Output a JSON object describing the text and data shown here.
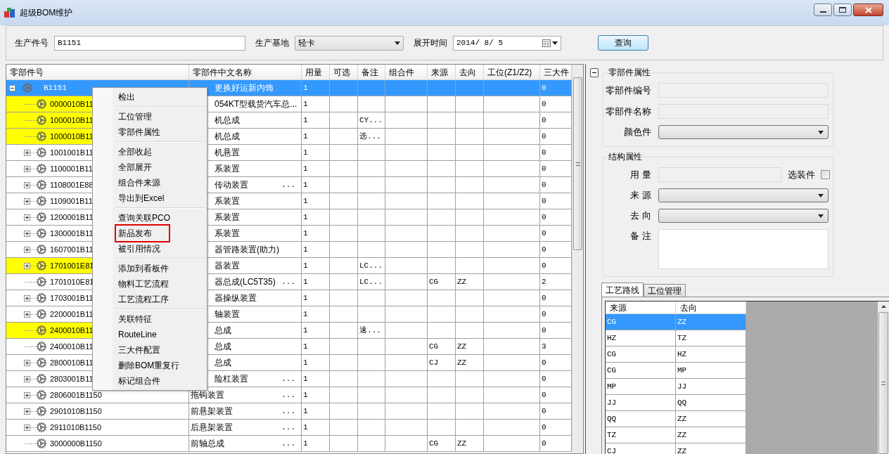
{
  "window": {
    "title": "超级BOM维护"
  },
  "query": {
    "fields": [
      {
        "kind": "text",
        "label": "生产件号",
        "value": "B1151"
      },
      {
        "kind": "select",
        "label": "生产基地",
        "value": "轻卡"
      },
      {
        "kind": "date",
        "label": "展开时间",
        "value": "2014/ 8/ 5"
      }
    ],
    "button": "查询"
  },
  "bom_grid": {
    "columns": [
      "零部件号",
      "零部件中文名称",
      "用量",
      "可选",
      "备注",
      "组合件",
      "来源",
      "去向",
      "工位(Z1/Z2)",
      "三大件"
    ],
    "tree": {
      "part": "B1151",
      "name": "更换好运新内饰",
      "qty": "1",
      "three": "0",
      "selected": true,
      "expanded": true,
      "children": [
        {
          "part": "0000010B11",
          "name": "054KT型载货汽车总...",
          "qty": "1",
          "three": "0",
          "highlight": true,
          "expandable": false
        },
        {
          "part": "1000010B11",
          "name": "机总成",
          "qty": "1",
          "remark": "CY...",
          "three": "0",
          "highlight": true,
          "expandable": false
        },
        {
          "part": "1000010B11",
          "name": "机总成",
          "qty": "1",
          "remark": "选...",
          "three": "0",
          "highlight": true,
          "expandable": false
        },
        {
          "part": "1001001B11",
          "name": "机悬置",
          "qty": "1",
          "three": "0",
          "highlight": false,
          "expandable": true
        },
        {
          "part": "1100001B11",
          "name": "系装置",
          "qty": "1",
          "three": "0",
          "highlight": false,
          "expandable": true
        },
        {
          "part": "1108001E88",
          "name": "传动装置",
          "ellipsis": "...",
          "qty": "1",
          "three": "0",
          "highlight": false,
          "expandable": true
        },
        {
          "part": "1109001B11",
          "name": "系装置",
          "qty": "1",
          "three": "0",
          "highlight": false,
          "expandable": true
        },
        {
          "part": "1200001B11",
          "name": "系装置",
          "qty": "1",
          "three": "0",
          "highlight": false,
          "expandable": true
        },
        {
          "part": "1300001B11",
          "name": "系装置",
          "qty": "1",
          "three": "0",
          "highlight": false,
          "expandable": true
        },
        {
          "part": "1607001B11",
          "name": "器管路装置(助力)",
          "qty": "1",
          "three": "0",
          "highlight": false,
          "expandable": true
        },
        {
          "part": "1701001E81",
          "name": "器装置",
          "qty": "1",
          "remark": "LC...",
          "three": "0",
          "highlight": true,
          "expandable": true
        },
        {
          "part": "1701010E81",
          "name": "器总成(LC5T35)",
          "ellipsis": "...",
          "qty": "1",
          "remark": "LC...",
          "source": "CG",
          "dest": "ZZ",
          "three": "2",
          "highlight": false,
          "expandable": false
        },
        {
          "part": "1703001B11",
          "name": "器操纵装置",
          "qty": "1",
          "three": "0",
          "highlight": false,
          "expandable": true
        },
        {
          "part": "2200001B11",
          "name": "轴装置",
          "qty": "1",
          "three": "0",
          "highlight": false,
          "expandable": true
        },
        {
          "part": "2400010B11",
          "name": "总成",
          "qty": "1",
          "remark": "速...",
          "three": "0",
          "highlight": true,
          "expandable": false
        },
        {
          "part": "2400010B11",
          "name": "总成",
          "qty": "1",
          "source": "CG",
          "dest": "ZZ",
          "three": "3",
          "highlight": false,
          "expandable": false
        },
        {
          "part": "2800010B11",
          "name": "总成",
          "qty": "1",
          "source": "CJ",
          "dest": "ZZ",
          "three": "0",
          "highlight": false,
          "expandable": true
        },
        {
          "part": "2803001B11",
          "name": "险杠装置",
          "ellipsis": "...",
          "qty": "1",
          "three": "0",
          "highlight": false,
          "expandable": true
        },
        {
          "part": "2806001B1150",
          "name": "拖钩装置",
          "ellipsis": "...",
          "qty": "1",
          "three": "0",
          "highlight": false,
          "expandable": true
        },
        {
          "part": "2901010B1150",
          "name": "前悬架装置",
          "ellipsis": "...",
          "qty": "1",
          "three": "0",
          "highlight": false,
          "expandable": true
        },
        {
          "part": "2911010B1150",
          "name": "后悬架装置",
          "ellipsis": "...",
          "qty": "1",
          "three": "0",
          "highlight": false,
          "expandable": true
        },
        {
          "part": "3000000B1150",
          "name": "前轴总成",
          "ellipsis": "...",
          "qty": "1",
          "source": "CG",
          "dest": "ZZ",
          "three": "0",
          "highlight": false,
          "expandable": false
        }
      ]
    }
  },
  "context_menu": {
    "groups": [
      [
        {
          "label": "检出",
          "marked": false
        }
      ],
      [
        {
          "label": "工位管理",
          "marked": false
        },
        {
          "label": "零部件属性",
          "marked": false
        }
      ],
      [
        {
          "label": "全部收起",
          "marked": false
        },
        {
          "label": "全部展开",
          "marked": false
        },
        {
          "label": "组合件来源",
          "marked": false
        },
        {
          "label": "导出到Excel",
          "marked": false
        }
      ],
      [
        {
          "label": "查询关联PCO",
          "marked": false
        },
        {
          "label": "新品发布",
          "marked": true
        },
        {
          "label": "被引用情况",
          "marked": false
        }
      ],
      [
        {
          "label": "添加到看板件",
          "marked": false
        },
        {
          "label": "物料工艺流程",
          "marked": false
        },
        {
          "label": "工艺流程工序",
          "marked": false
        }
      ],
      [
        {
          "label": "关联特征",
          "marked": false
        },
        {
          "label": "RouteLine",
          "marked": false
        },
        {
          "label": "三大件配置",
          "marked": false
        },
        {
          "label": "删除BOM重复行",
          "marked": false
        },
        {
          "label": "标记组合件",
          "marked": false
        }
      ]
    ]
  },
  "properties": {
    "groups": [
      {
        "title": "零部件属性",
        "fields": [
          {
            "kind": "text",
            "label": "零部件编号",
            "disabled": true
          },
          {
            "kind": "text",
            "label": "零部件名称",
            "disabled": true
          },
          {
            "kind": "select",
            "label": "颜色件"
          }
        ]
      },
      {
        "title": "结构属性",
        "fields": [
          {
            "kind": "text",
            "label": "用 量",
            "disabled": true,
            "checkbox": {
              "label": "选装件",
              "checked": false
            }
          },
          {
            "kind": "select",
            "label": "来 源"
          },
          {
            "kind": "select",
            "label": "去 向"
          },
          {
            "kind": "textarea",
            "label": "备 注"
          }
        ]
      }
    ]
  },
  "tabs": [
    {
      "label": "工艺路线",
      "selected": true
    },
    {
      "label": "工位管理",
      "selected": false
    }
  ],
  "route_grid": {
    "columns": [
      "来源",
      "去向"
    ],
    "rows": [
      {
        "source": "CG",
        "dest": "ZZ",
        "selected": true
      },
      {
        "source": "HZ",
        "dest": "TZ",
        "selected": false
      },
      {
        "source": "CG",
        "dest": "HZ",
        "selected": false
      },
      {
        "source": "CG",
        "dest": "MP",
        "selected": false
      },
      {
        "source": "MP",
        "dest": "JJ",
        "selected": false
      },
      {
        "source": "JJ",
        "dest": "QQ",
        "selected": false
      },
      {
        "source": "QQ",
        "dest": "ZZ",
        "selected": false
      },
      {
        "source": "TZ",
        "dest": "ZZ",
        "selected": false
      },
      {
        "source": "CJ",
        "dest": "ZZ",
        "selected": false
      }
    ]
  }
}
